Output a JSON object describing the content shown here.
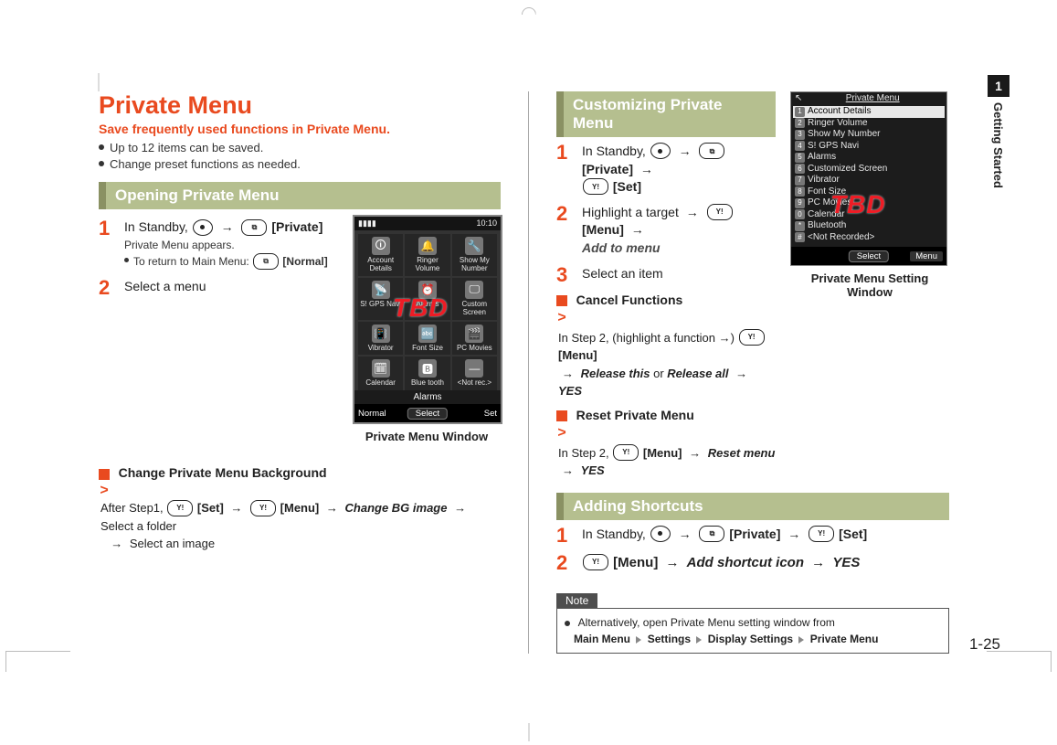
{
  "side": {
    "tab_num": "1",
    "section_label": "Getting Started"
  },
  "page_number": "1-25",
  "left": {
    "title": "Private Menu",
    "subtitle": "Save frequently used functions in Private Menu.",
    "intro_bullets": [
      "Up to 12 items can be saved.",
      "Change preset functions as needed."
    ],
    "opening": {
      "heading": "Opening Private Menu",
      "step1_prefix": "In Standby, ",
      "key_private": "[Private]",
      "step1_sub": "Private Menu appears.",
      "step1_sub2_prefix": "To return to Main Menu: ",
      "key_normal": "[Normal]",
      "step2": "Select a menu",
      "device_caption": "Private Menu Window",
      "phone_status": {
        "signal": "▮▮▮▮",
        "time": "10:10"
      },
      "grid": [
        {
          "label": "Account Details",
          "glyph": "🛈"
        },
        {
          "label": "Ringer Volume",
          "glyph": "🔔"
        },
        {
          "label": "Show My Number",
          "glyph": "🔧"
        },
        {
          "label": "S! GPS Navi",
          "glyph": "📡"
        },
        {
          "label": "Alarms",
          "glyph": "⏰"
        },
        {
          "label": "Custom Screen",
          "glyph": "🖵"
        },
        {
          "label": "Vibrator",
          "glyph": "📳"
        },
        {
          "label": "Font Size",
          "glyph": "🔤"
        },
        {
          "label": "PC Movies",
          "glyph": "🎬"
        },
        {
          "label": "Calendar",
          "glyph": "🗓"
        },
        {
          "label": "Blue tooth",
          "glyph": "🅱"
        },
        {
          "label": "<Not rec.>",
          "glyph": "—"
        }
      ],
      "grid_highlight_label": "Alarms",
      "softkeys": {
        "left": "Normal",
        "center": "Select",
        "right": "Set"
      },
      "tbd": "TBD"
    },
    "change_bg": {
      "title": "Change Private Menu Background",
      "line_prefix": "After Step1, ",
      "key_set": "[Set]",
      "key_menu": "[Menu]",
      "change_bg_image": "Change BG image",
      "select_folder": " Select a folder ",
      "select_image": " Select an image"
    }
  },
  "right": {
    "custom": {
      "heading": "Customizing Private Menu",
      "step1_prefix": "In Standby, ",
      "key_private": "[Private]",
      "key_set": "[Set]",
      "step2_prefix": "Highlight a target ",
      "key_menu": "[Menu]",
      "add_to_menu": "Add to menu",
      "step3": "Select an item",
      "cancel_title": "Cancel Functions",
      "cancel_line_prefix": "In Step 2, (highlight a function →) ",
      "release_this": "Release this",
      "or": " or ",
      "release_all": "Release all",
      "yes": "YES",
      "reset_title": "Reset Private Menu",
      "reset_prefix": "In Step 2, ",
      "reset_menu": "Reset menu"
    },
    "setting_window": {
      "title": "Private Menu",
      "caption": "Private Menu Setting Window",
      "items": [
        {
          "n": "1",
          "label": "Account Details",
          "hi": true
        },
        {
          "n": "2",
          "label": "Ringer Volume"
        },
        {
          "n": "3",
          "label": "Show My Number"
        },
        {
          "n": "4",
          "label": "S! GPS Navi"
        },
        {
          "n": "5",
          "label": "Alarms"
        },
        {
          "n": "6",
          "label": "Customized Screen"
        },
        {
          "n": "7",
          "label": "Vibrator"
        },
        {
          "n": "8",
          "label": "Font Size"
        },
        {
          "n": "9",
          "label": "PC Movies"
        },
        {
          "n": "0",
          "label": "Calendar"
        },
        {
          "n": "*",
          "label": "Bluetooth"
        },
        {
          "n": "#",
          "label": "<Not Recorded>"
        }
      ],
      "softkeys": {
        "left": "",
        "center": "Select",
        "right": "Menu"
      },
      "tbd": "TBD"
    },
    "shortcuts": {
      "heading": "Adding Shortcuts",
      "step1_prefix": "In Standby, ",
      "key_private": "[Private]",
      "key_set": "[Set]",
      "key_menu": "[Menu]",
      "add_shortcut": "Add shortcut icon",
      "yes": "YES"
    },
    "note": {
      "title": "Note",
      "line_prefix": "Alternatively, open Private Menu setting window from",
      "path": [
        "Main Menu",
        "Settings",
        "Display Settings",
        "Private Menu"
      ]
    }
  }
}
